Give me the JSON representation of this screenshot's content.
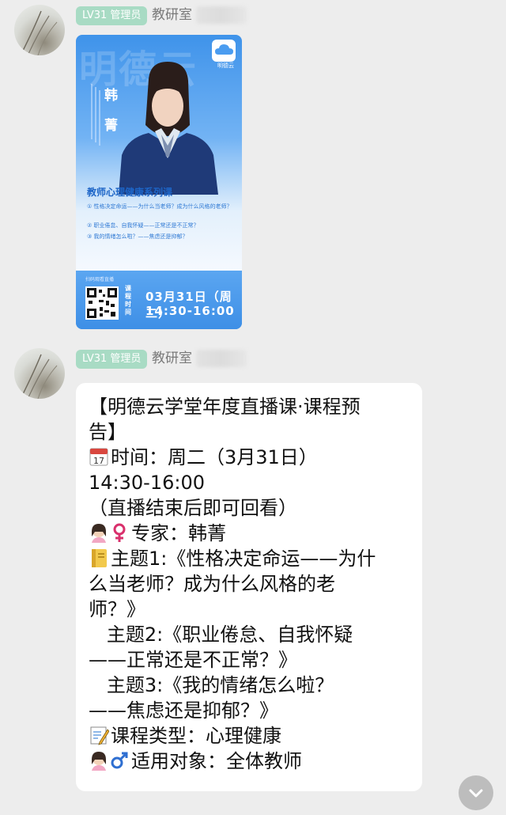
{
  "messages": [
    {
      "badge": "LV31 管理员",
      "sender": "教研室",
      "poster": {
        "bg_text": "明德云",
        "logo_label": "明德云",
        "name_chars": [
          "韩",
          "菁"
        ],
        "course_title": "教师心理健康系列课",
        "topics": [
          "① 性格决定命运——为什么当老师？成为什么风格的老师？",
          "② 职业倦怠、自我怀疑——正常还是不正常？",
          "③ 我的情绪怎么啦？——焦虑还是抑郁？"
        ],
        "qr_label": "扫码观看直播",
        "time_label": "课程时间",
        "date": "03月31日（周二）",
        "time": "14:30-16:00"
      }
    },
    {
      "badge": "LV31 管理员",
      "sender": "教研室",
      "text_lines": [
        {
          "emoji": "",
          "text": "【明德云学堂年度直播课·课程预"
        },
        {
          "emoji": "",
          "text": "告】"
        },
        {
          "emoji": "calendar-icon",
          "text": "时间：周二（3月31日）"
        },
        {
          "emoji": "",
          "text": "14:30-16:00"
        },
        {
          "emoji": "",
          "text": "（直播结束后即可回看）"
        },
        {
          "emoji": "woman-female-icon",
          "text": "专家：韩菁"
        },
        {
          "emoji": "notebook-icon",
          "text": "主题1:《性格决定命运——为什"
        },
        {
          "emoji": "",
          "text": "么当老师？成为什么风格的老"
        },
        {
          "emoji": "",
          "text": "师？》"
        },
        {
          "emoji": "",
          "text": "   主题2:《职业倦怠、自我怀疑"
        },
        {
          "emoji": "",
          "text": "——正常还是不正常？》"
        },
        {
          "emoji": "",
          "text": "   主题3:《我的情绪怎么啦？"
        },
        {
          "emoji": "",
          "text": "——焦虑还是抑郁？》"
        },
        {
          "emoji": "memo-icon",
          "text": "课程类型：心理健康"
        },
        {
          "emoji": "woman-male-icon",
          "text": "适用对象：全体教师"
        }
      ]
    }
  ],
  "scroll_button": {
    "icon": "chevron-down-icon"
  },
  "colors": {
    "badge": "#a8dbc4",
    "background": "#ededed",
    "poster_blue": "#3f93ea"
  }
}
